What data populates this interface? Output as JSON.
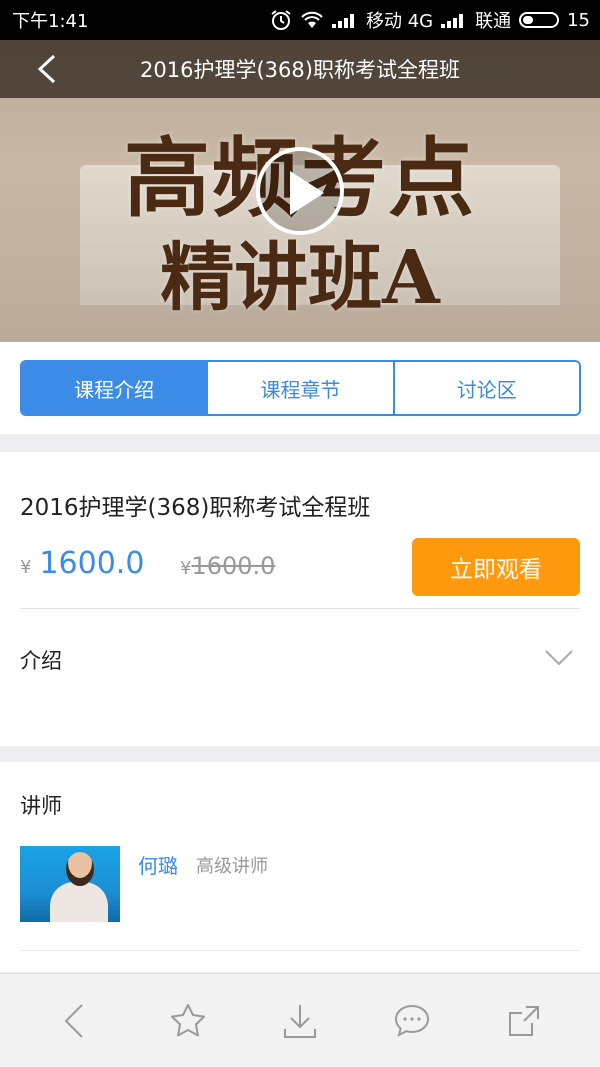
{
  "status": {
    "time": "下午1:41",
    "carrier1": "移动 4G",
    "carrier2": "联通",
    "battery": "15"
  },
  "header": {
    "title": "2016护理学(368)职称考试全程班"
  },
  "hero": {
    "line1": "高频考点",
    "line2": "精讲班A"
  },
  "tabs": [
    {
      "label": "课程介绍",
      "active": true
    },
    {
      "label": "课程章节",
      "active": false
    },
    {
      "label": "讨论区",
      "active": false
    }
  ],
  "course": {
    "title": "2016护理学(368)职称考试全程班",
    "currency": "¥",
    "price": "1600.0",
    "original_price": "1600.0",
    "watch_label": "立即观看",
    "intro_label": "介绍"
  },
  "teacher": {
    "section_label": "讲师",
    "name": "何璐",
    "title": "高级讲师"
  },
  "colors": {
    "accent": "#3b8be7",
    "button": "#ff9a0e"
  },
  "icons": {
    "bottom": [
      "back-icon",
      "star-icon",
      "download-icon",
      "chat-icon",
      "share-icon"
    ]
  }
}
